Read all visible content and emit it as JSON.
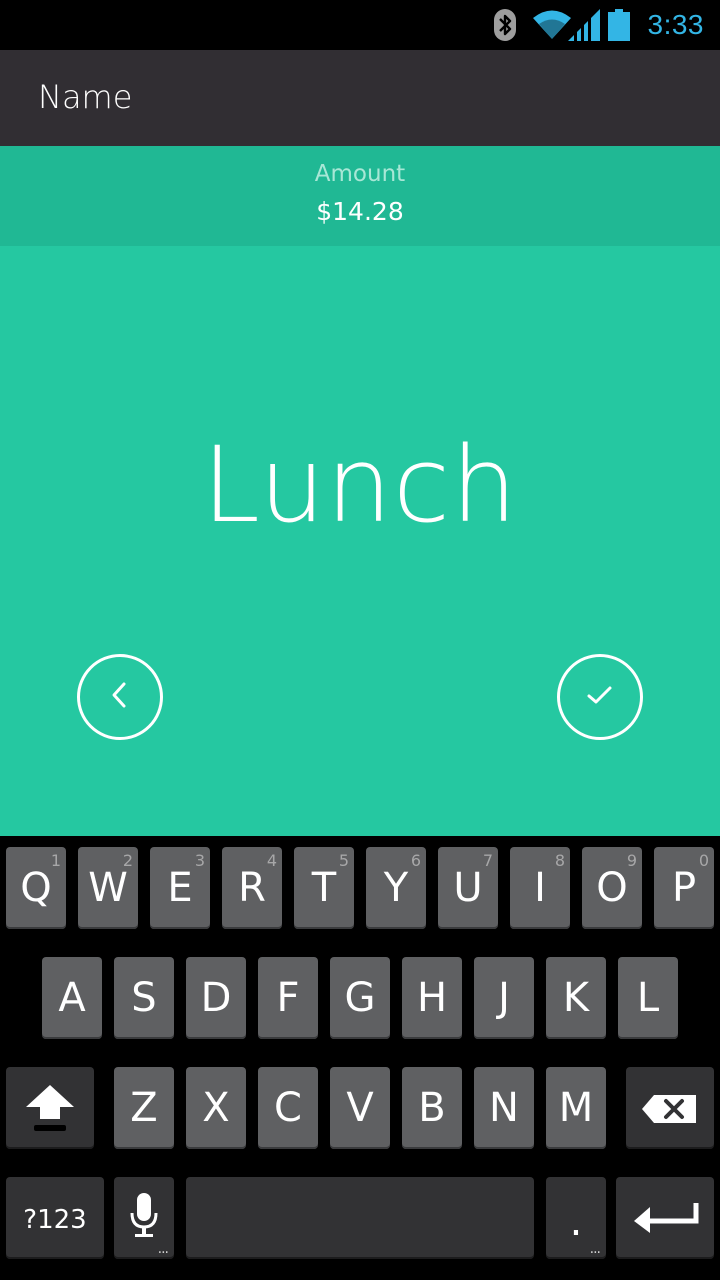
{
  "status_bar": {
    "time": "3:33",
    "icons": [
      "bluetooth-icon",
      "wifi-icon",
      "signal-icon",
      "battery-icon"
    ],
    "accent": "#33b5e5"
  },
  "action_bar": {
    "title": "Name"
  },
  "amount": {
    "label": "Amount",
    "value": "$14.28"
  },
  "entry": {
    "value": "Lunch"
  },
  "actions": {
    "back_icon": "chevron-left-icon",
    "confirm_icon": "check-icon"
  },
  "colors": {
    "main": "#25c8a1",
    "amount_strip": "#20b894",
    "action_bar": "#312e33"
  },
  "keyboard": {
    "row1": [
      {
        "key": "Q",
        "sub": "1"
      },
      {
        "key": "W",
        "sub": "2"
      },
      {
        "key": "E",
        "sub": "3"
      },
      {
        "key": "R",
        "sub": "4"
      },
      {
        "key": "T",
        "sub": "5"
      },
      {
        "key": "Y",
        "sub": "6"
      },
      {
        "key": "U",
        "sub": "7"
      },
      {
        "key": "I",
        "sub": "8"
      },
      {
        "key": "O",
        "sub": "9"
      },
      {
        "key": "P",
        "sub": "0"
      }
    ],
    "row2": [
      "A",
      "S",
      "D",
      "F",
      "G",
      "H",
      "J",
      "K",
      "L"
    ],
    "row3": [
      "Z",
      "X",
      "C",
      "V",
      "B",
      "N",
      "M"
    ],
    "symbols_label": "?123",
    "period_label": ".",
    "more_indicator": "..."
  }
}
